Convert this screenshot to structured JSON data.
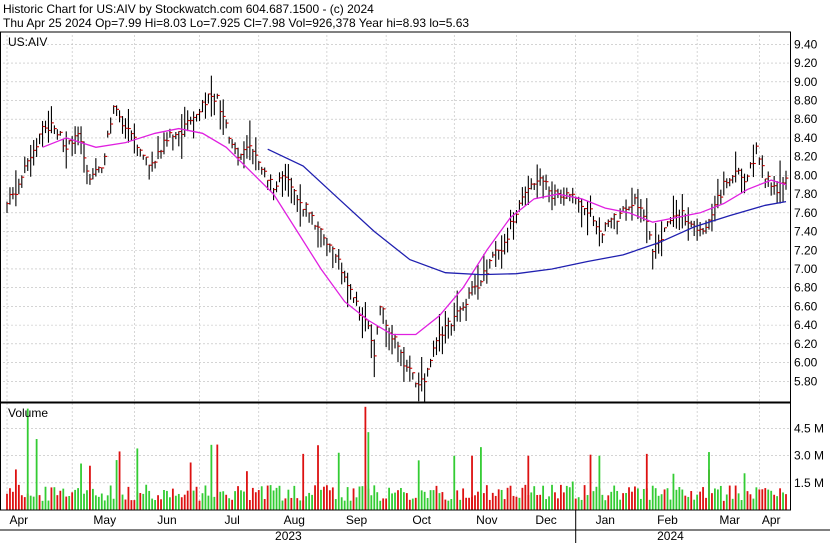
{
  "header": {
    "line1": "Historic Chart for US:AIV by Stockwatch.com 604.687.1500 - (c) 2024",
    "line2": "Thu Apr 25 2024   Op=7.99   Hi=8.03   Lo=7.925   Cl=7.98   Vol=926,378   Year hi=8.93   lo=5.63"
  },
  "colors": {
    "up_bar": "#000000",
    "close_tick": "#cc0000",
    "ma_short": "#e020e0",
    "ma_long": "#2020b0",
    "vol_up": "#33cc33",
    "vol_down": "#dd1111",
    "grid": "#bbbbbb"
  },
  "chart_data": [
    {
      "type": "ohlc",
      "title": "US:AIV",
      "ylim": [
        5.6,
        9.5
      ],
      "y_ticks": [
        "9.40",
        "9.20",
        "9.00",
        "8.80",
        "8.60",
        "8.40",
        "8.20",
        "8.00",
        "7.80",
        "7.60",
        "7.40",
        "7.20",
        "7.00",
        "6.80",
        "6.60",
        "6.40",
        "6.20",
        "6.00",
        "5.80"
      ],
      "x_months": [
        "Apr",
        "May",
        "Jun",
        "Jul",
        "Aug",
        "Sep",
        "Oct",
        "Nov",
        "Dec",
        "Jan",
        "Feb",
        "Mar",
        "Apr"
      ],
      "x_years": [
        "2023",
        "2024"
      ],
      "grid": true,
      "price_points": [
        [
          0,
          7.7
        ],
        [
          4,
          7.9
        ],
        [
          8,
          8.2
        ],
        [
          12,
          8.5
        ],
        [
          16,
          8.55
        ],
        [
          20,
          8.3
        ],
        [
          24,
          8.4
        ],
        [
          28,
          8.0
        ],
        [
          32,
          8.1
        ],
        [
          36,
          8.7
        ],
        [
          40,
          8.5
        ],
        [
          44,
          8.3
        ],
        [
          48,
          8.1
        ],
        [
          52,
          8.3
        ],
        [
          56,
          8.45
        ],
        [
          60,
          8.5
        ],
        [
          64,
          8.7
        ],
        [
          68,
          8.85
        ],
        [
          71,
          8.8
        ],
        [
          74,
          8.5
        ],
        [
          78,
          8.2
        ],
        [
          82,
          8.3
        ],
        [
          86,
          8.05
        ],
        [
          90,
          7.9
        ],
        [
          94,
          8.0
        ],
        [
          98,
          7.75
        ],
        [
          102,
          7.6
        ],
        [
          106,
          7.4
        ],
        [
          110,
          7.2
        ],
        [
          114,
          6.9
        ],
        [
          118,
          6.6
        ],
        [
          122,
          6.45
        ],
        [
          124,
          6.1
        ],
        [
          126,
          6.6
        ],
        [
          130,
          6.3
        ],
        [
          134,
          6.0
        ],
        [
          138,
          5.8
        ],
        [
          141,
          5.8
        ],
        [
          144,
          6.2
        ],
        [
          148,
          6.4
        ],
        [
          152,
          6.5
        ],
        [
          156,
          6.7
        ],
        [
          160,
          6.9
        ],
        [
          164,
          7.1
        ],
        [
          168,
          7.3
        ],
        [
          172,
          7.6
        ],
        [
          176,
          7.9
        ],
        [
          180,
          8.0
        ],
        [
          184,
          7.8
        ],
        [
          188,
          7.8
        ],
        [
          192,
          7.75
        ],
        [
          196,
          7.65
        ],
        [
          200,
          7.4
        ],
        [
          204,
          7.5
        ],
        [
          208,
          7.6
        ],
        [
          212,
          7.7
        ],
        [
          216,
          7.55
        ],
        [
          218,
          7.2
        ],
        [
          222,
          7.4
        ],
        [
          226,
          7.6
        ],
        [
          230,
          7.55
        ],
        [
          234,
          7.4
        ],
        [
          238,
          7.6
        ],
        [
          242,
          7.9
        ],
        [
          246,
          8.1
        ],
        [
          250,
          7.95
        ],
        [
          253,
          8.3
        ],
        [
          256,
          8.0
        ],
        [
          260,
          7.85
        ],
        [
          263,
          7.95
        ]
      ],
      "series": [
        {
          "name": "",
          "points": [
            [
              12,
              8.3
            ],
            [
              20,
              8.4
            ],
            [
              30,
              8.3
            ],
            [
              40,
              8.35
            ],
            [
              50,
              8.45
            ],
            [
              58,
              8.5
            ],
            [
              66,
              8.45
            ],
            [
              74,
              8.3
            ],
            [
              82,
              8.05
            ],
            [
              90,
              7.8
            ],
            [
              98,
              7.4
            ],
            [
              106,
              7.0
            ],
            [
              114,
              6.65
            ],
            [
              122,
              6.45
            ],
            [
              130,
              6.3
            ],
            [
              138,
              6.3
            ],
            [
              146,
              6.5
            ],
            [
              154,
              6.8
            ],
            [
              162,
              7.2
            ],
            [
              170,
              7.55
            ],
            [
              178,
              7.75
            ],
            [
              186,
              7.8
            ],
            [
              194,
              7.75
            ],
            [
              202,
              7.65
            ],
            [
              210,
              7.6
            ],
            [
              218,
              7.5
            ],
            [
              226,
              7.55
            ],
            [
              234,
              7.6
            ],
            [
              242,
              7.7
            ],
            [
              250,
              7.85
            ],
            [
              258,
              7.95
            ],
            [
              263,
              7.9
            ]
          ]
        },
        {
          "name": "",
          "points": [
            [
              88,
              8.28
            ],
            [
              100,
              8.1
            ],
            [
              112,
              7.75
            ],
            [
              124,
              7.4
            ],
            [
              136,
              7.1
            ],
            [
              148,
              6.96
            ],
            [
              160,
              6.94
            ],
            [
              172,
              6.95
            ],
            [
              184,
              7.0
            ],
            [
              196,
              7.08
            ],
            [
              208,
              7.15
            ],
            [
              220,
              7.28
            ],
            [
              232,
              7.45
            ],
            [
              244,
              7.57
            ],
            [
              256,
              7.68
            ],
            [
              263,
              7.72
            ]
          ]
        }
      ]
    },
    {
      "type": "bar",
      "title": "Volume",
      "ylim": [
        0,
        5.8
      ],
      "y_ticks": [
        "4.5 M",
        "3.0 M",
        "1.5 M"
      ]
    }
  ]
}
